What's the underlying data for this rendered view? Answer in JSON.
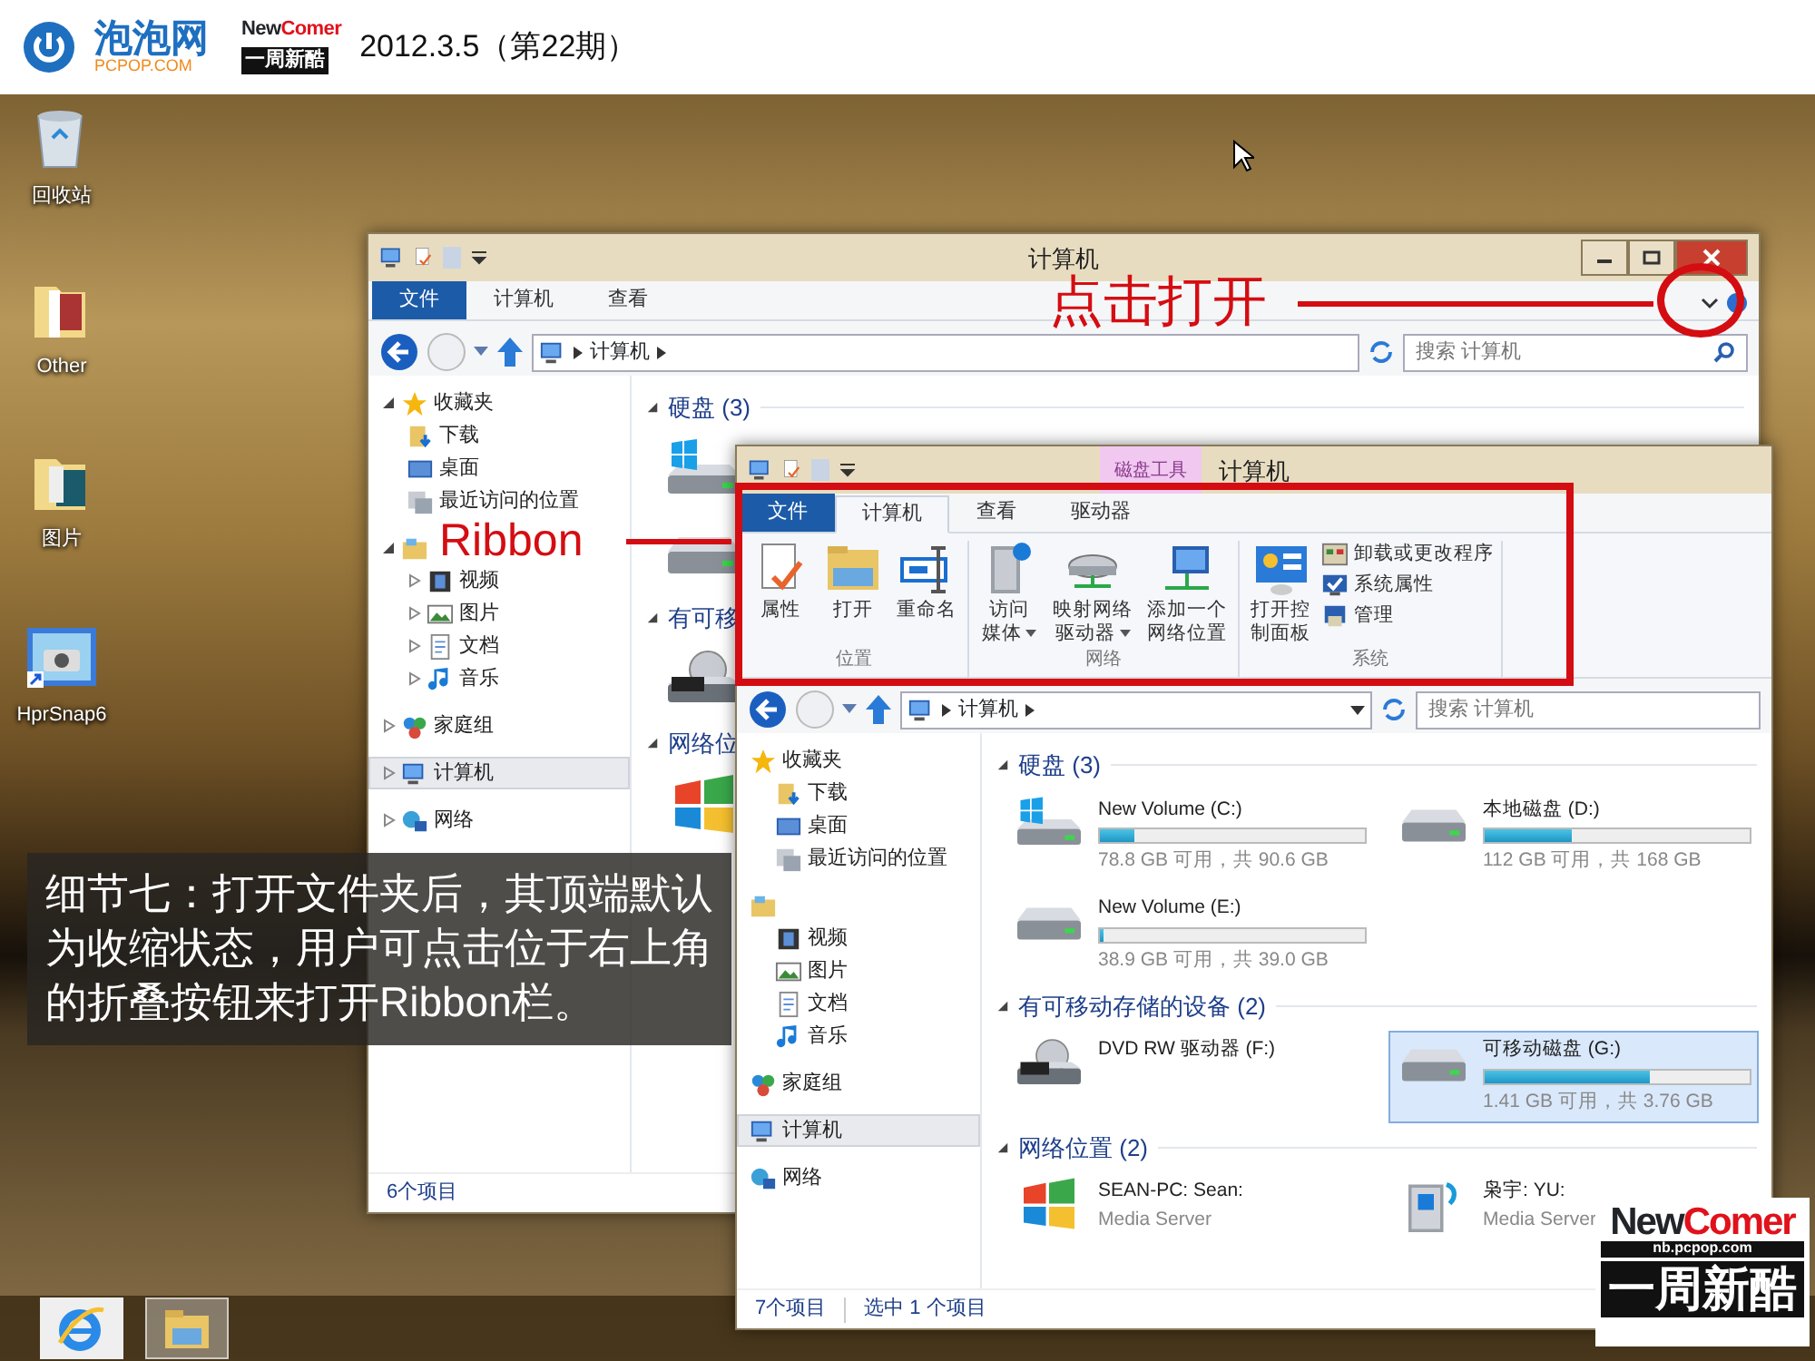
{
  "header": {
    "site_name": "泡泡网",
    "site_domain": "PCPOP.COM",
    "brand_parts": [
      "New",
      "Comer"
    ],
    "column_name": "一周新酷",
    "issue": "2012.3.5（第22期）"
  },
  "desktop_icons": [
    {
      "label": "回收站",
      "kind": "recycle_bin"
    },
    {
      "label": "Other",
      "kind": "folder_other"
    },
    {
      "label": "图片",
      "kind": "folder_pictures"
    },
    {
      "label": "HprSnap6",
      "kind": "shortcut_camera"
    }
  ],
  "taskbar": [
    {
      "kind": "ie",
      "selected": false
    },
    {
      "kind": "explorer",
      "selected": true
    }
  ],
  "back_window": {
    "title": "计算机",
    "ribbon_expanded": false,
    "tabs": [
      {
        "label": "文件",
        "kind": "file",
        "selected": false
      },
      {
        "label": "计算机",
        "kind": "tab",
        "selected": false
      },
      {
        "label": "查看",
        "kind": "tab",
        "selected": false
      }
    ],
    "address": "计算机",
    "search_placeholder": "搜索 计算机",
    "nav": [
      {
        "label": "收藏夹",
        "kind": "favorites",
        "expanded": true,
        "selected": false,
        "children": [
          {
            "label": "下载",
            "kind": "download",
            "selected": false
          },
          {
            "label": "桌面",
            "kind": "desktop",
            "selected": false
          },
          {
            "label": "最近访问的位置",
            "kind": "recent",
            "selected": false
          }
        ]
      },
      {
        "kind": "library",
        "expanded": true,
        "selected": false,
        "children": [
          {
            "label": "视频",
            "kind": "video",
            "expanded": false,
            "selected": false
          },
          {
            "label": "图片",
            "kind": "pictures",
            "expanded": false,
            "selected": false
          },
          {
            "label": "文档",
            "kind": "documents",
            "expanded": false,
            "selected": false
          },
          {
            "label": "音乐",
            "kind": "music",
            "expanded": false,
            "selected": false
          }
        ]
      },
      {
        "label": "家庭组",
        "kind": "homegroup",
        "expanded": false,
        "selected": false
      },
      {
        "label": "计算机",
        "kind": "computer",
        "expanded": false,
        "selected": true
      },
      {
        "label": "网络",
        "kind": "network",
        "expanded": false,
        "selected": false
      }
    ],
    "groups": [
      {
        "title": "硬盘 (3)",
        "items": [
          {
            "kind": "windows_drive"
          },
          {
            "kind": "drive"
          }
        ]
      },
      {
        "title": "有可移",
        "items": [
          {
            "kind": "dvd"
          }
        ]
      },
      {
        "title": "网络位",
        "items": [
          {
            "kind": "media_player"
          }
        ]
      }
    ],
    "status": [
      "6个项目"
    ]
  },
  "front_window": {
    "title": "计算机",
    "context_tab": "磁盘工具",
    "ribbon_expanded": true,
    "tabs": [
      {
        "label": "文件",
        "kind": "file",
        "selected": false
      },
      {
        "label": "计算机",
        "kind": "tab",
        "selected": true
      },
      {
        "label": "查看",
        "kind": "tab",
        "selected": false
      },
      {
        "label": "驱动器",
        "kind": "tab",
        "selected": false
      }
    ],
    "ribbon": [
      {
        "title": "位置",
        "commands": [
          {
            "lines": [
              "属性"
            ],
            "kind": "properties",
            "dropdown": false
          },
          {
            "lines": [
              "打开"
            ],
            "kind": "open",
            "dropdown": false
          },
          {
            "lines": [
              "重命名"
            ],
            "kind": "rename",
            "dropdown": false
          }
        ]
      },
      {
        "title": "网络",
        "commands": [
          {
            "lines": [
              "访问",
              "媒体"
            ],
            "kind": "media",
            "dropdown": true
          },
          {
            "lines": [
              "映射网络",
              "驱动器"
            ],
            "kind": "map_drive",
            "dropdown": true
          },
          {
            "lines": [
              "添加一个",
              "网络位置"
            ],
            "kind": "add_location",
            "dropdown": false
          }
        ]
      },
      {
        "title": "系统",
        "commands": [
          {
            "lines": [
              "打开控",
              "制面板"
            ],
            "kind": "control_panel",
            "dropdown": false
          }
        ],
        "links": [
          {
            "label": "卸载或更改程序",
            "kind": "uninstall"
          },
          {
            "label": "系统属性",
            "kind": "sys_props"
          },
          {
            "label": "管理",
            "kind": "manage"
          }
        ]
      }
    ],
    "address": "计算机",
    "search_placeholder": "搜索 计算机",
    "nav": [
      {
        "label": "收藏夹",
        "kind": "favorites",
        "selected": false,
        "children": [
          {
            "label": "下载",
            "kind": "download",
            "selected": false
          },
          {
            "label": "桌面",
            "kind": "desktop",
            "selected": false
          },
          {
            "label": "最近访问的位置",
            "kind": "recent",
            "selected": false
          }
        ]
      },
      {
        "kind": "library",
        "selected": false,
        "children": [
          {
            "label": "视频",
            "kind": "video",
            "selected": false
          },
          {
            "label": "图片",
            "kind": "pictures",
            "selected": false
          },
          {
            "label": "文档",
            "kind": "documents",
            "selected": false
          },
          {
            "label": "音乐",
            "kind": "music",
            "selected": false
          }
        ]
      },
      {
        "label": "家庭组",
        "kind": "homegroup",
        "selected": false
      },
      {
        "label": "计算机",
        "kind": "computer",
        "selected": true
      },
      {
        "label": "网络",
        "kind": "network",
        "selected": false
      }
    ],
    "groups": [
      {
        "title": "硬盘 (3)",
        "items": [
          {
            "name": "New Volume (C:)",
            "kind": "windows_drive",
            "level": 0.13,
            "detail": "78.8 GB 可用，共 90.6 GB",
            "selected": false
          },
          {
            "name": "本地磁盘 (D:)",
            "kind": "drive",
            "level": 0.33,
            "detail": "112 GB 可用，共 168 GB",
            "selected": false
          },
          {
            "name": "New Volume (E:)",
            "kind": "drive",
            "level": 0.003,
            "detail": "38.9 GB 可用，共 39.0 GB",
            "selected": false
          }
        ]
      },
      {
        "title": "有可移动存储的设备 (2)",
        "items": [
          {
            "name": "DVD RW 驱动器 (F:)",
            "kind": "dvd",
            "selected": false
          },
          {
            "name": "可移动磁盘 (G:)",
            "kind": "drive",
            "level": 0.62,
            "detail": "1.41 GB 可用，共 3.76 GB",
            "selected": true
          }
        ]
      },
      {
        "title": "网络位置 (2)",
        "items": [
          {
            "name": "SEAN-PC: Sean:",
            "kind": "media_player",
            "detail": "Media Server",
            "selected": false
          },
          {
            "name": "枭宇: YU:",
            "kind": "media_server",
            "detail": "Media Server",
            "selected": false
          }
        ]
      }
    ],
    "status": [
      "7个项目",
      "选中 1 个项目"
    ]
  },
  "callouts": [
    {
      "text": "点击打开",
      "kind": "circle"
    },
    {
      "text": "Ribbon",
      "kind": "rectangle"
    }
  ],
  "caption": "细节七：打开文件夹后，其顶端默认为收缩状态，用户可点击位于右上角的折叠按钮来打开Ribbon栏。",
  "corner_logo": {
    "brand_parts": [
      "New",
      "Comer"
    ],
    "url": "nb.pcpop.com",
    "column_name": "一周新酷"
  }
}
